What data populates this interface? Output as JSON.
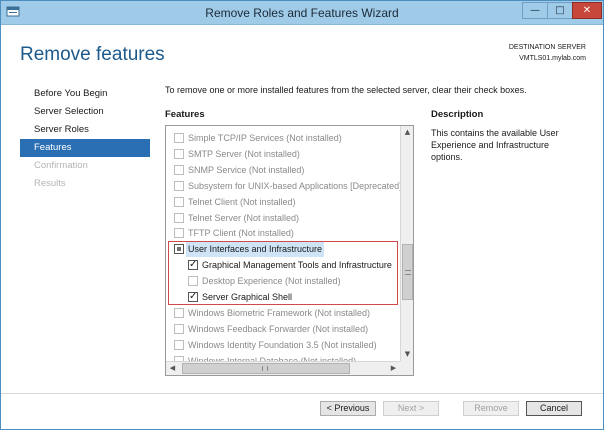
{
  "window": {
    "title": "Remove Roles and Features Wizard",
    "minimize": "—",
    "maximize": "□",
    "close": "✕"
  },
  "header": {
    "heading": "Remove features",
    "destination_label": "DESTINATION SERVER",
    "destination_server": "VMTLS01.mylab.com"
  },
  "nav": {
    "items": [
      {
        "label": "Before You Begin",
        "state": "normal"
      },
      {
        "label": "Server Selection",
        "state": "normal"
      },
      {
        "label": "Server Roles",
        "state": "normal"
      },
      {
        "label": "Features",
        "state": "active"
      },
      {
        "label": "Confirmation",
        "state": "disabled"
      },
      {
        "label": "Results",
        "state": "disabled"
      }
    ]
  },
  "main": {
    "instructions": "To remove one or more installed features from the selected server, clear their check boxes.",
    "features_label": "Features",
    "description_label": "Description",
    "description_text": "This contains the available User Experience and Infrastructure options."
  },
  "features": [
    {
      "label": "Simple TCP/IP Services (Not installed)",
      "level": 0,
      "state": "unchecked",
      "enabled": false
    },
    {
      "label": "SMTP Server (Not installed)",
      "level": 0,
      "state": "unchecked",
      "enabled": false
    },
    {
      "label": "SNMP Service (Not installed)",
      "level": 0,
      "state": "unchecked",
      "enabled": false
    },
    {
      "label": "Subsystem for UNIX-based Applications [Deprecated]",
      "level": 0,
      "state": "unchecked",
      "enabled": false
    },
    {
      "label": "Telnet Client (Not installed)",
      "level": 0,
      "state": "unchecked",
      "enabled": false
    },
    {
      "label": "Telnet Server (Not installed)",
      "level": 0,
      "state": "unchecked",
      "enabled": false
    },
    {
      "label": "TFTP Client (Not installed)",
      "level": 0,
      "state": "unchecked",
      "enabled": false
    },
    {
      "label": "User Interfaces and Infrastructure",
      "level": 0,
      "state": "partial",
      "enabled": true,
      "highlight": true
    },
    {
      "label": "Graphical Management Tools and Infrastructure",
      "level": 1,
      "state": "checked",
      "enabled": true
    },
    {
      "label": "Desktop Experience (Not installed)",
      "level": 1,
      "state": "unchecked",
      "enabled": false
    },
    {
      "label": "Server Graphical Shell",
      "level": 1,
      "state": "checked",
      "enabled": true
    },
    {
      "label": "Windows Biometric Framework (Not installed)",
      "level": 0,
      "state": "unchecked",
      "enabled": false
    },
    {
      "label": "Windows Feedback Forwarder (Not installed)",
      "level": 0,
      "state": "unchecked",
      "enabled": false
    },
    {
      "label": "Windows Identity Foundation 3.5 (Not installed)",
      "level": 0,
      "state": "unchecked",
      "enabled": false
    },
    {
      "label": "Windows Internal Database (Not installed)",
      "level": 0,
      "state": "unchecked",
      "enabled": false
    }
  ],
  "scroll": {
    "up": "▲",
    "down": "▼",
    "left": "◀",
    "right": "▶"
  },
  "footer": {
    "previous": "< Previous",
    "next": "Next >",
    "remove": "Remove",
    "cancel": "Cancel"
  }
}
